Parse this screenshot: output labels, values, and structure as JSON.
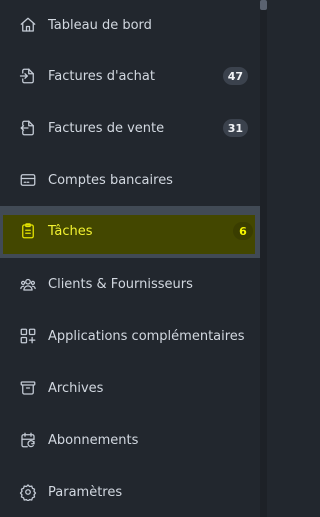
{
  "sidebar": {
    "items": [
      {
        "label": "Tableau de bord",
        "icon": "home-icon"
      },
      {
        "label": "Factures d'achat",
        "icon": "invoice-in-icon",
        "badge": "47"
      },
      {
        "label": "Factures de vente",
        "icon": "invoice-out-icon",
        "badge": "31"
      },
      {
        "label": "Comptes bancaires",
        "icon": "credit-card-icon"
      },
      {
        "label": "Tâches",
        "icon": "clipboard-icon",
        "badge": "6",
        "active": true
      },
      {
        "label": "Clients & Fournisseurs",
        "icon": "users-icon"
      },
      {
        "label": "Applications complémentaires",
        "icon": "apps-plus-icon"
      },
      {
        "label": "Archives",
        "icon": "archive-icon"
      },
      {
        "label": "Abonnements",
        "icon": "calendar-repeat-icon"
      },
      {
        "label": "Paramètres",
        "icon": "gear-icon"
      }
    ]
  },
  "colors": {
    "background": "#22272e",
    "active_row": "#414a55",
    "active_highlight": "#434700",
    "active_text": "#f2f230",
    "badge": "#3b424d"
  }
}
